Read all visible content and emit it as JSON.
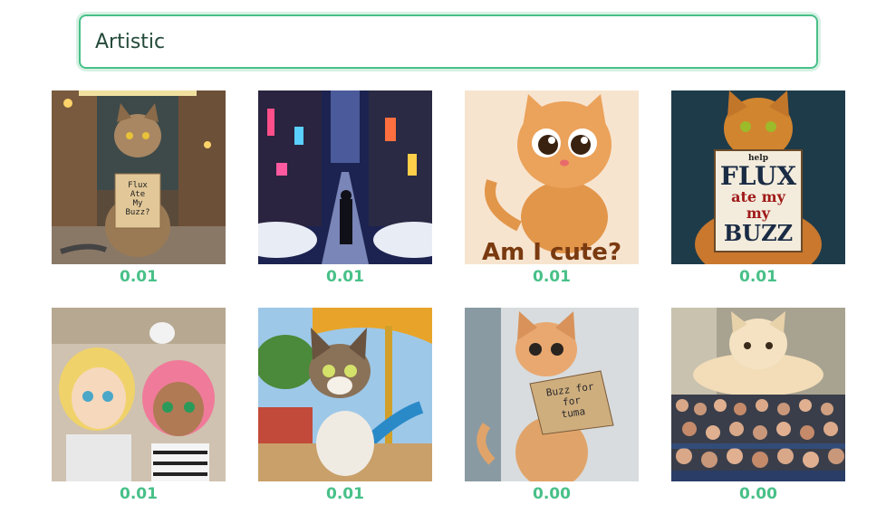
{
  "search": {
    "value": "Artistic"
  },
  "images": [
    {
      "name": "cat-sign-flux-ate-my-buzz",
      "sign_text": [
        "Flux",
        "Ate",
        "My",
        "Buzz?"
      ],
      "score": "0.01"
    },
    {
      "name": "anime-city-street",
      "score": "0.01"
    },
    {
      "name": "cute-orange-kitten-am-i-cute",
      "caption": "Am I cute?",
      "score": "0.01"
    },
    {
      "name": "cat-sign-help-flux",
      "sign_text": [
        "help",
        "FLUX",
        "ate my",
        "my",
        "BUZZ"
      ],
      "score": "0.01"
    },
    {
      "name": "anime-characters-elves",
      "score": "0.01"
    },
    {
      "name": "tabby-kitten-playground",
      "score": "0.01"
    },
    {
      "name": "kitten-sign-buzz-for-tuma",
      "sign_text": [
        "Buzz for",
        "for",
        "tuma"
      ],
      "score": "0.00"
    },
    {
      "name": "cat-over-crowd",
      "score": "0.00"
    }
  ]
}
